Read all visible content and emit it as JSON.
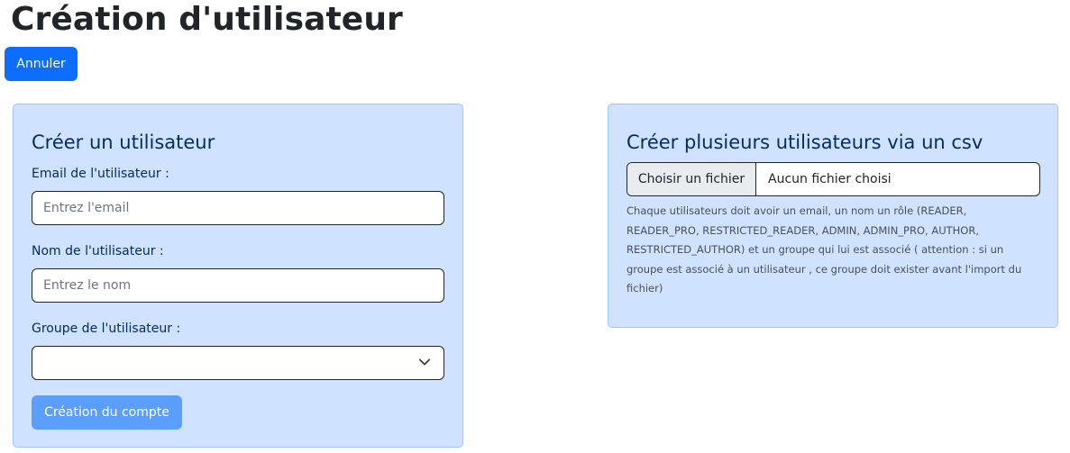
{
  "page": {
    "title": "Création d'utilisateur",
    "cancel_label": "Annuler"
  },
  "single_user_form": {
    "title": "Créer un utilisateur",
    "email_label": "Email de l'utilisateur :",
    "email_placeholder": "Entrez l'email",
    "email_value": "",
    "name_label": "Nom de l'utilisateur :",
    "name_placeholder": "Entrez le nom",
    "name_value": "",
    "group_label": "Groupe de l'utilisateur :",
    "group_selected": "",
    "submit_label": "Création du compte"
  },
  "csv_import": {
    "title": "Créer plusieurs utilisateurs via un csv",
    "choose_file_label": "Choisir un fichier",
    "file_status": "Aucun fichier choisi",
    "help_text": "Chaque utilisateurs doit avoir un email, un nom un rôle (READER, READER_PRO, RESTRICTED_READER, ADMIN, ADMIN_PRO, AUTHOR, RESTRICTED_AUTHOR) et un groupe qui lui est associé ( attention : si un groupe est associé à un utilisateur , ce groupe doit exister avant l'import du fichier)"
  },
  "icons": {
    "select_arrow": "chevron-down-icon"
  },
  "colors": {
    "primary": "#0d6efd",
    "primary_disabled": "#5a9ffd",
    "card_background": "#cfe2ff",
    "card_border": "#9ec5fe",
    "card_text": "#052c65"
  }
}
